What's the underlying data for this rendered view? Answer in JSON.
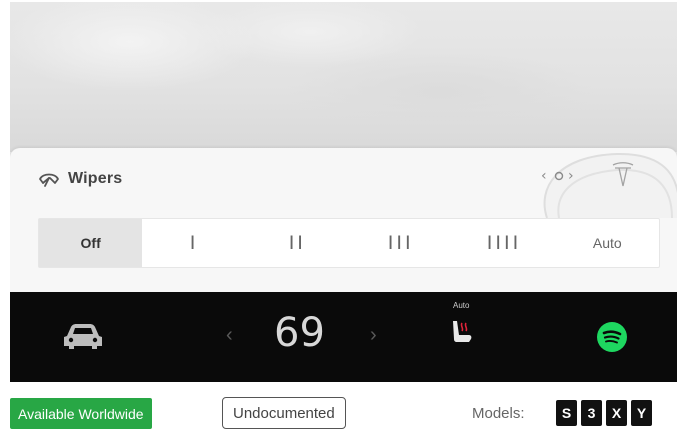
{
  "wipers": {
    "title": "Wipers",
    "icon": "wiper-icon",
    "options": [
      "Off",
      "I",
      "II",
      "III",
      "IIII",
      "Auto"
    ],
    "selected": "Off"
  },
  "climate": {
    "temperature": "69",
    "seat_heater_label": "Auto"
  },
  "badges": {
    "availability": "Available Worldwide",
    "documentation": "Undocumented",
    "models_label": "Models:",
    "models": [
      "S",
      "3",
      "X",
      "Y"
    ]
  },
  "colors": {
    "availability_badge": "#28a745",
    "climate_bar": "#0a0a0a",
    "spotify": "#1ed760"
  }
}
